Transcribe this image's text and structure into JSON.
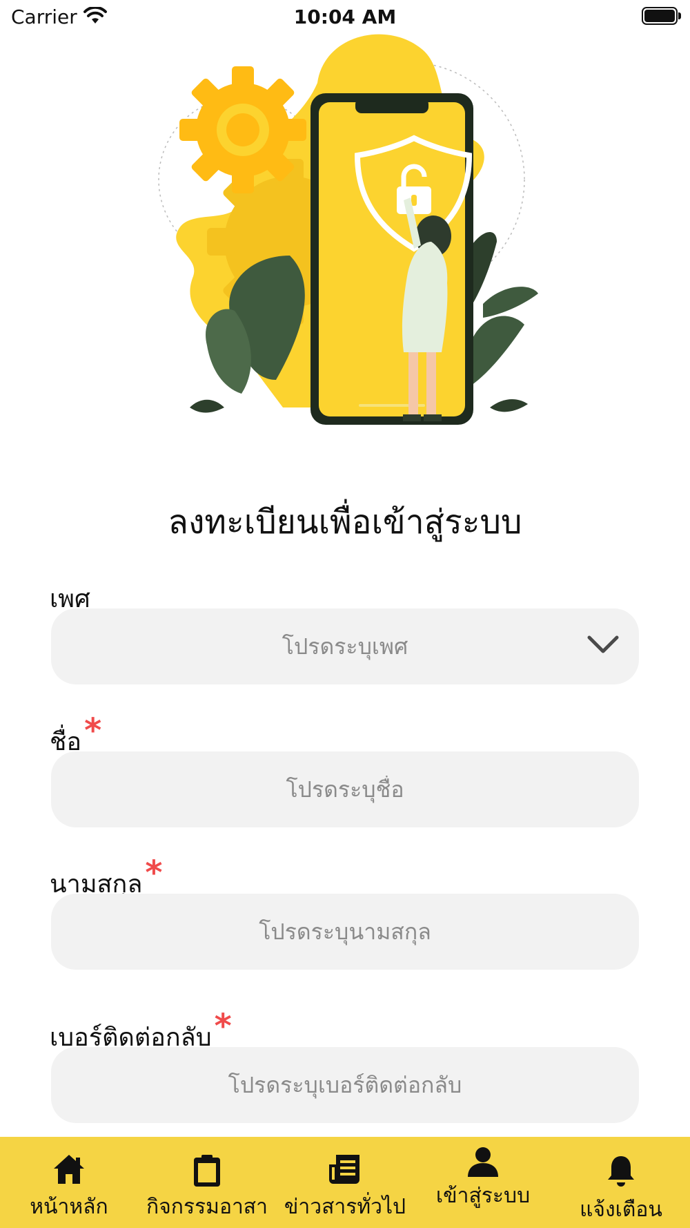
{
  "status_bar": {
    "carrier": "Carrier",
    "time": "10:04 AM"
  },
  "page": {
    "title": "ลงทะเบียนเพื่อเข้าสู่ระบบ"
  },
  "form": {
    "gender": {
      "label": "เพศ",
      "placeholder": "โปรดระบุเพศ"
    },
    "first_name": {
      "label": "ชื่อ",
      "required_mark": "*",
      "placeholder": "โปรดระบุชื่อ"
    },
    "last_name": {
      "label": "นามสกุล",
      "required_mark": "*",
      "placeholder": "โปรดระบุนามสกุล"
    },
    "phone": {
      "label": "เบอร์ติดต่อกลับ",
      "required_mark": "*",
      "placeholder": "โปรดระบุเบอร์ติดต่อกลับ"
    }
  },
  "tab_bar": {
    "active_index": 3,
    "items": [
      {
        "label": "หน้าหลัก",
        "icon": "home-icon"
      },
      {
        "label": "กิจกรรมอาสา",
        "icon": "clipboard-icon"
      },
      {
        "label": "ข่าวสารทั่วไป",
        "icon": "news-icon"
      },
      {
        "label": "เข้าสู่ระบบ",
        "icon": "user-icon"
      },
      {
        "label": "แจ้งเตือน",
        "icon": "bell-icon"
      }
    ]
  },
  "colors": {
    "accent_yellow": "#f5d444",
    "illustration_yellow": "#fcd32f",
    "required_red": "#f04b4b",
    "field_background": "#f2f2f2",
    "leaf_green": "#3f5a3e"
  }
}
